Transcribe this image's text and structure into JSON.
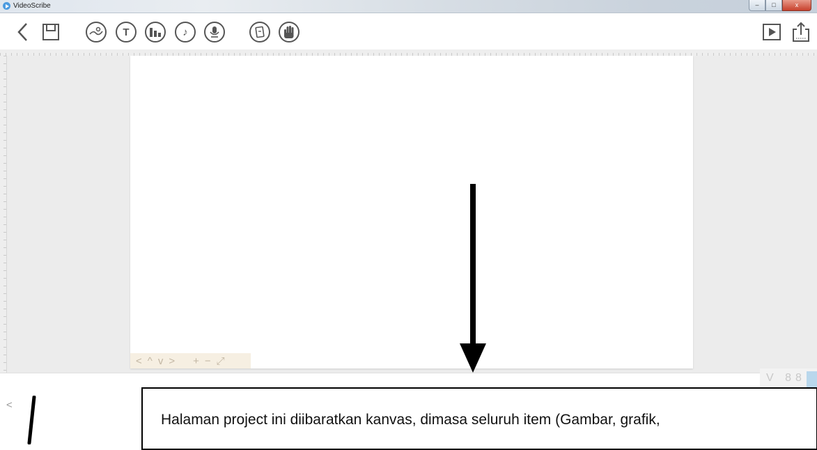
{
  "window": {
    "title": "VideoScribe",
    "controls": {
      "minimize": "–",
      "maximize": "□",
      "close": "x"
    }
  },
  "toolbar": {
    "left_tools": [
      {
        "name": "back-icon"
      },
      {
        "name": "save-icon"
      }
    ],
    "insert_tools": [
      {
        "name": "image-icon"
      },
      {
        "name": "text-icon",
        "glyph": "T"
      },
      {
        "name": "chart-icon"
      },
      {
        "name": "music-icon",
        "glyph": "♪"
      },
      {
        "name": "voiceover-icon"
      }
    ],
    "extra_tools": [
      {
        "name": "background-icon"
      },
      {
        "name": "hand-icon"
      }
    ],
    "right_tools": [
      {
        "name": "play-icon"
      },
      {
        "name": "share-icon"
      }
    ]
  },
  "canvas_nav": {
    "prev": "<",
    "up": "^",
    "down": "v",
    "next": ">",
    "zoom_in": "+",
    "zoom_out": "−",
    "fit": "⤢"
  },
  "timeline": {
    "scroll_left": "<",
    "icons": "V 88"
  },
  "annotation": {
    "text": "Halaman project ini diibaratkan kanvas, dimasa seluruh item (Gambar, grafik,"
  },
  "colors": {
    "titlebar": "#dfe6ee",
    "workspace": "#ececec",
    "canvas": "#ffffff",
    "nav_bg": "#f6efe2",
    "timeline_highlight": "#b9d7ec"
  }
}
